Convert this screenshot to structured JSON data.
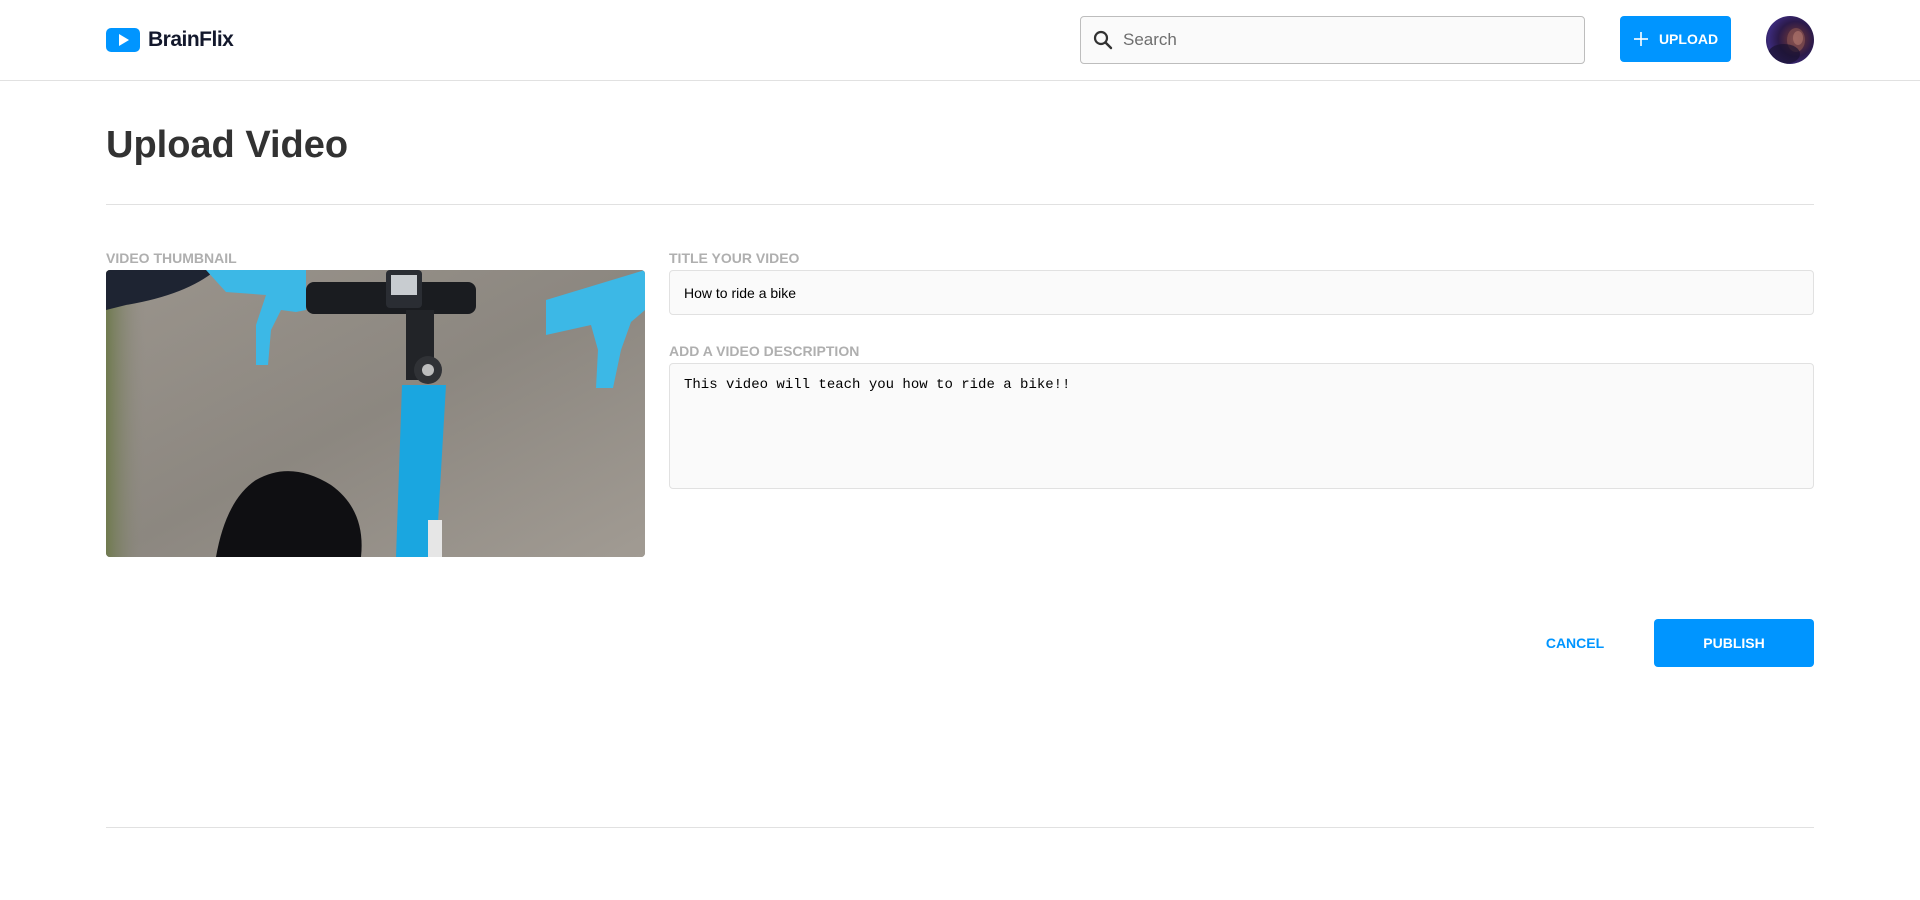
{
  "brand": {
    "name": "BrainFlix",
    "logo_icon": "play-icon",
    "accent_color": "#0095ff"
  },
  "header": {
    "search": {
      "placeholder": "Search",
      "value": "",
      "icon": "search-icon"
    },
    "upload_label": "UPLOAD",
    "upload_icon": "plus-icon",
    "avatar": "user-avatar"
  },
  "page": {
    "title": "Upload Video"
  },
  "form": {
    "thumbnail_label": "VIDEO THUMBNAIL",
    "thumbnail_image": "bicycle-handlebar-photo",
    "title_label": "TITLE YOUR VIDEO",
    "title_value": "How to ride a bike",
    "description_label": "ADD A VIDEO DESCRIPTION",
    "description_value": "This video will teach you how to ride a bike!!",
    "cancel_label": "CANCEL",
    "publish_label": "PUBLISH"
  }
}
